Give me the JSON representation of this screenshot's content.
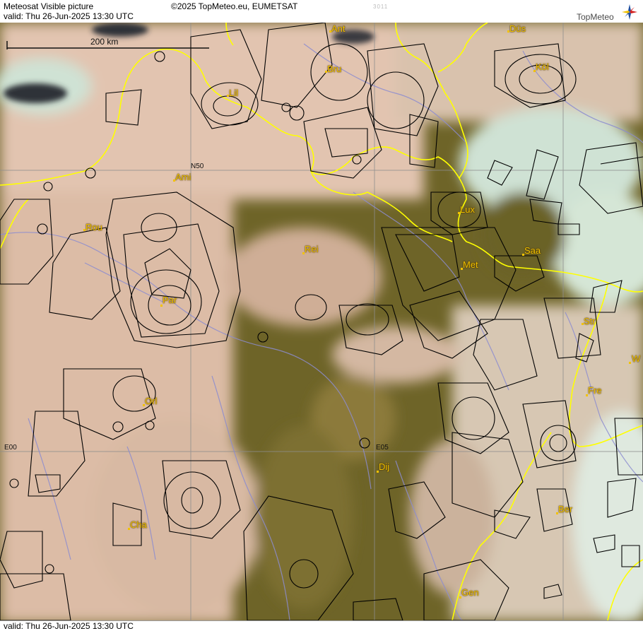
{
  "header": {
    "title": "Meteosat Visible picture",
    "valid": "valid:  Thu  26-Jun-2025  13:30 UTC",
    "copyright": "©2025 TopMeteo.eu, EUMETSAT",
    "code": "3011",
    "brand": "TopMeteo"
  },
  "footer": {
    "valid": "valid:  Thu  26-Jun-2025  13:30 UTC"
  },
  "scale": {
    "label": "200 km"
  },
  "grid_labels": {
    "n50": "N50",
    "e00": "E00",
    "e05": "E05"
  },
  "cities": {
    "ant": "Ant",
    "dus": "Düs",
    "bru": "Bru",
    "koln": "Köl",
    "lil": "Lil",
    "ami": "Ami",
    "rou": "Rou",
    "lux": "Lux",
    "rei": "Rei",
    "saa": "Saa",
    "met": "Met",
    "par": "Par",
    "str": "Str",
    "w": "W",
    "orl": "Orl",
    "fre": "Fre",
    "dij": "Dij",
    "ber": "Ber",
    "cha": "Cha",
    "gen": "Gen"
  },
  "colors": {
    "land": "#6e6428",
    "cloud": "#e2c4b0",
    "haze": "#cfe2d4",
    "border": "#ffff00",
    "river": "#8c8cd0",
    "airspace": "#000000",
    "city": "#f2c200"
  }
}
